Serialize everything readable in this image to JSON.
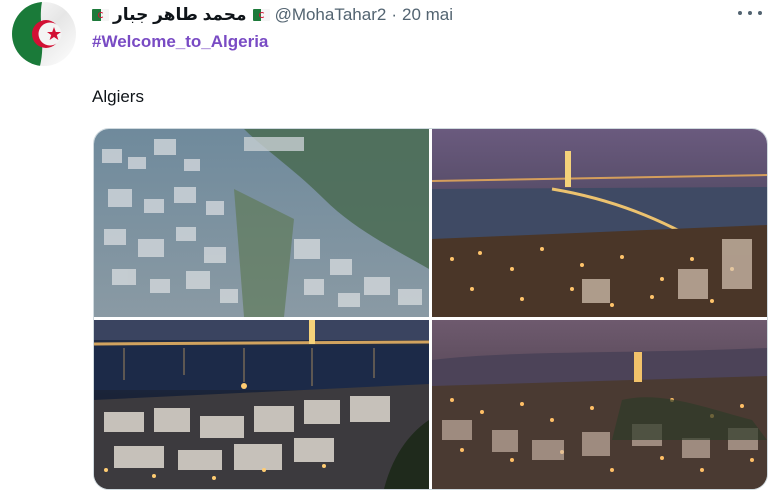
{
  "author": {
    "display_name": "محمد طاهر جبار",
    "handle": "@MohaTahar2",
    "separator": "·",
    "date": "20 mai",
    "flag_icon": "algeria-flag-icon"
  },
  "tweet": {
    "hashtag": "#Welcome_to_Algeria",
    "text": "Algiers"
  },
  "colors": {
    "hashtag": "#794bc4",
    "secondary_text": "#536471",
    "primary_text": "#0f1419",
    "border": "#cfd9de"
  },
  "media": {
    "photos": [
      {
        "name": "algiers-aerial-day-photo"
      },
      {
        "name": "algiers-bay-night-photo"
      },
      {
        "name": "algiers-waterfront-night-photo"
      },
      {
        "name": "algiers-hills-dusk-photo"
      }
    ]
  }
}
